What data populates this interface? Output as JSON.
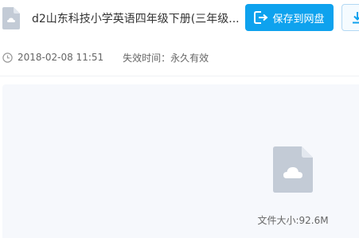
{
  "header": {
    "title": "d2山东科技小学英语四年级下册(三年级...",
    "save_button_label": "保存到网盘"
  },
  "meta": {
    "date": "2018-02-08 11:51",
    "expire_label": "失效时间：",
    "expire_value": "永久有效"
  },
  "preview": {
    "file_size": "文件大小:92.6M"
  },
  "icons": {
    "doc": "document-icon",
    "save": "save-icon",
    "download": "download-icon",
    "clock": "clock-icon",
    "file": "cloud-file-icon"
  },
  "colors": {
    "accent": "#0ea2ee",
    "icon_gray": "#c3cbd6",
    "preview_bg": "#f6f8fc"
  }
}
